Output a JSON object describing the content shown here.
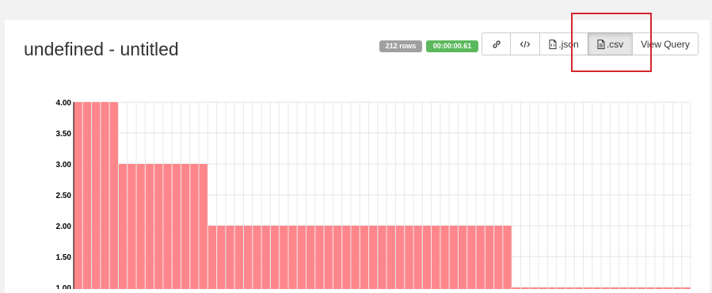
{
  "panel": {
    "title": "undefined - untitled",
    "rows_badge": "212 rows",
    "time_badge": "00:00:00.61",
    "colors": {
      "rows_badge": "#a0a0a0",
      "time_badge": "#5cb85c",
      "highlight": "#d3262c",
      "bar": "#ff878b"
    }
  },
  "toolbar": {
    "link_icon": "link-icon",
    "code_icon": "code-icon",
    "json_label": ".json",
    "csv_label": ".csv",
    "view_query_label": "View Query"
  },
  "chart_data": {
    "type": "bar",
    "title": "",
    "xlabel": "",
    "ylabel": "",
    "ylim": [
      1.0,
      4.0
    ],
    "yticks": [
      "4.00",
      "3.50",
      "3.00",
      "2.50",
      "2.00",
      "1.50",
      "1.00"
    ],
    "values": [
      4,
      4,
      4,
      4,
      4,
      3,
      3,
      3,
      3,
      3,
      3,
      3,
      3,
      3,
      3,
      2,
      2,
      2,
      2,
      2,
      2,
      2,
      2,
      2,
      2,
      2,
      2,
      2,
      2,
      2,
      2,
      2,
      2,
      2,
      2,
      2,
      2,
      2,
      2,
      2,
      2,
      2,
      2,
      2,
      2,
      2,
      2,
      2,
      2,
      1,
      1,
      1,
      1,
      1,
      1,
      1,
      1,
      1,
      1,
      1,
      1,
      1,
      1,
      1,
      1,
      1,
      1,
      1,
      1
    ]
  }
}
